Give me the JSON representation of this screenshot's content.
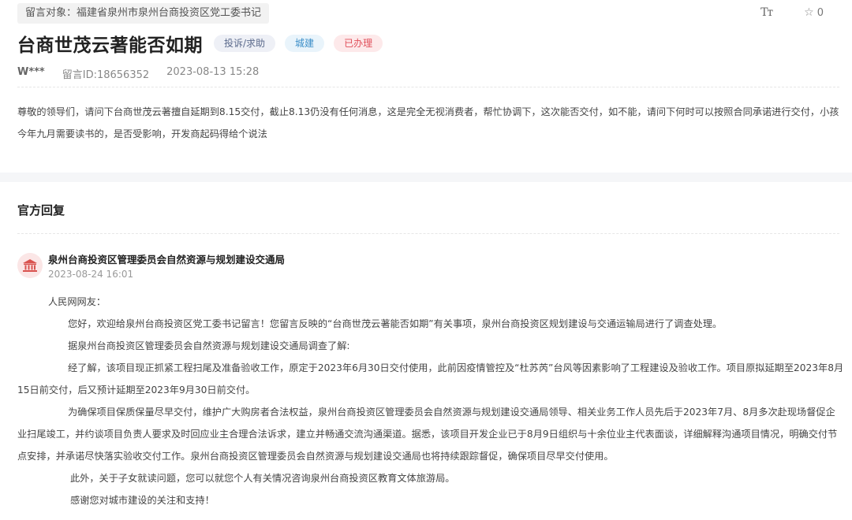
{
  "message": {
    "target_prefix": "留言对象：",
    "target": "福建省泉州市泉州台商投资区党工委书记",
    "title": "台商世茂云著能否如期",
    "badges": {
      "type": "投诉/求助",
      "domain": "城建",
      "status": "已办理"
    },
    "tools": {
      "font_size_label": "Tт",
      "favorite_count": "0"
    },
    "author": "W***",
    "id_label": "留言ID:18656352",
    "datetime": "2023-08-13 15:28",
    "content": "尊敬的领导们，请问下台商世茂云著擅自延期到8.15交付，截止8.13仍没有任何消息，这是完全无视消费者，帮忙协调下，这次能否交付，如不能，请问下何时可以按照合同承诺进行交付，小孩今年九月需要读书的，是否受影响，开发商起码得给个说法"
  },
  "reply": {
    "section_title": "官方回复",
    "org": "泉州台商投资区管理委员会自然资源与规划建设交通局",
    "time": "2023-08-24 16:01",
    "paragraphs": [
      "人民网网友：",
      "您好，欢迎给泉州台商投资区党工委书记留言！您留言反映的“台商世茂云著能否如期”有关事项，泉州台商投资区规划建设与交通运输局进行了调查处理。",
      "据泉州台商投资区管理委员会自然资源与规划建设交通局调查了解:",
      "经了解，该项目现正抓紧工程扫尾及准备验收工作，原定于2023年6月30日交付使用，此前因疫情管控及“杜苏芮”台风等因素影响了工程建设及验收工作。项目原拟延期至2023年8月15日前交付，后又预计延期至2023年9月30日前交付。",
      "为确保项目保质保量尽早交付，维护广大购房者合法权益，泉州台商投资区管理委员会自然资源与规划建设交通局领导、相关业务工作人员先后于2023年7月、8月多次赴现场督促企业扫尾竣工，并约谈项目负责人要求及时回应业主合理合法诉求，建立并畅通交流沟通渠道。据悉，该项目开发企业已于8月9日组织与十余位业主代表面谈，详细解释沟通项目情况，明确交付节点安排，并承诺尽快落实验收交付工作。泉州台商投资区管理委员会自然资源与规划建设交通局也将持续跟踪督促，确保项目尽早交付使用。",
      "此外，关于子女就读问题，您可以就您个人有关情况咨询泉州台商投资区教育文体旅游局。",
      "感谢您对城市建设的关注和支持！"
    ]
  },
  "colors": {
    "status_red": "#e04f5a",
    "domain_blue": "#3b8ec8",
    "avatar_red": "#d9534f"
  }
}
